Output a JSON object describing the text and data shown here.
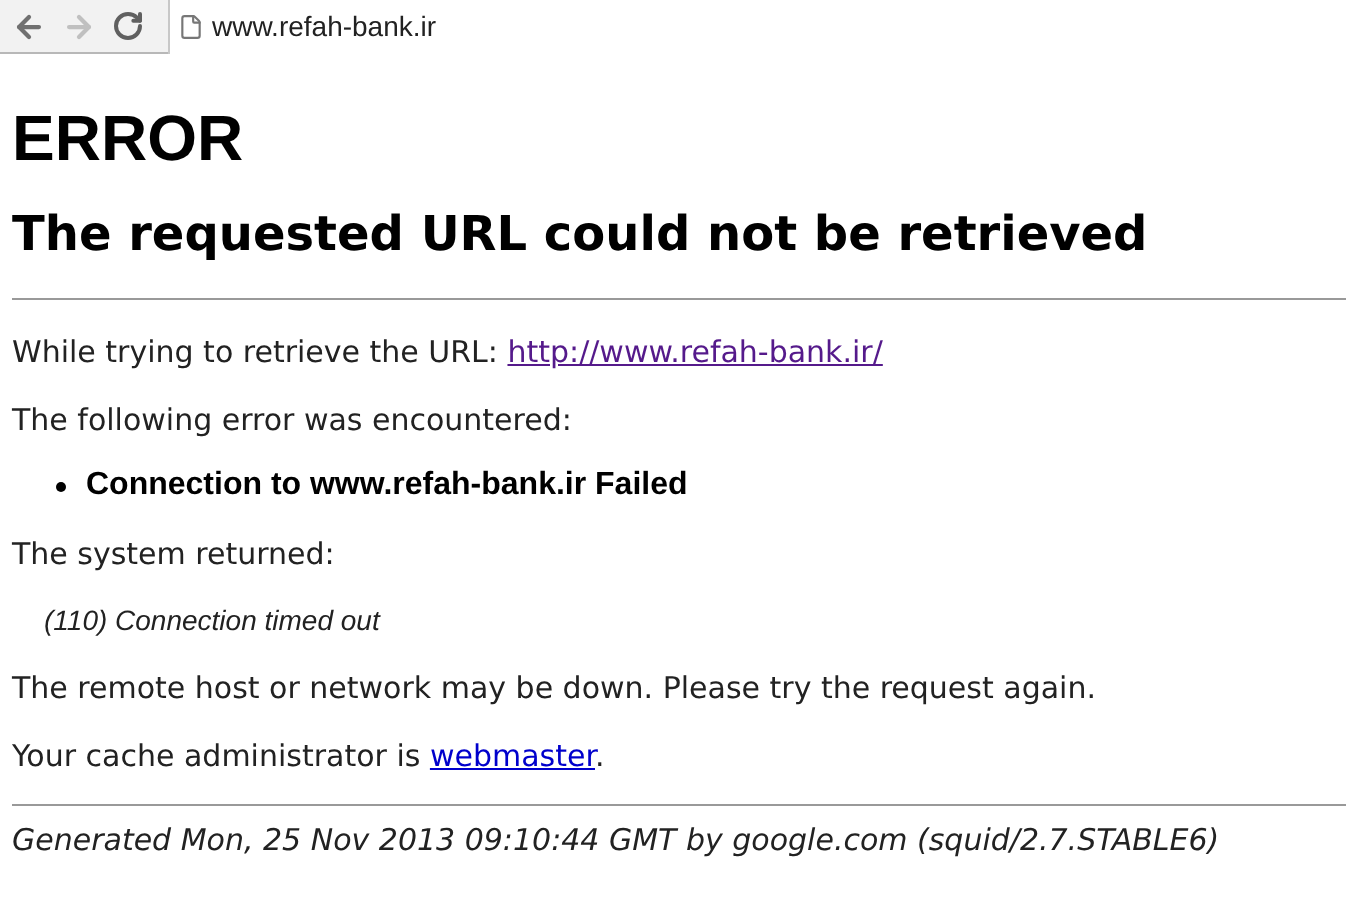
{
  "browser": {
    "address": "www.refah-bank.ir"
  },
  "heading": "ERROR",
  "subheading": "The requested URL could not be retrieved",
  "url_line": {
    "text": "While trying to retrieve the URL: ",
    "link": "http://www.refah-bank.ir/"
  },
  "error_intro": "The following error was encountered:",
  "errors": [
    "Connection to www.refah-bank.ir Failed"
  ],
  "system_intro": "The system returned:",
  "system_message": "(110) Connection timed out",
  "advice": "The remote host or network may be down. Please try the request again.",
  "admin_line": {
    "text": "Your cache administrator is ",
    "link": "webmaster",
    "after": "."
  },
  "footer": "Generated Mon, 25 Nov 2013 09:10:44 GMT by google.com (squid/2.7.STABLE6)"
}
